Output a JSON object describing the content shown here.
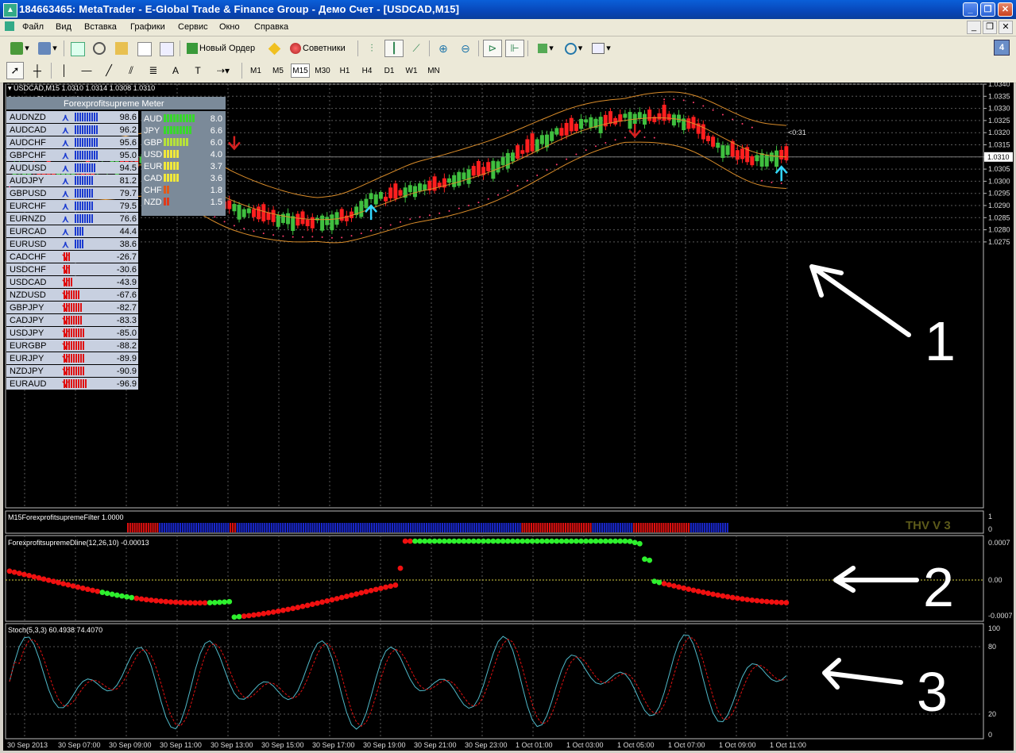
{
  "window": {
    "title": "184663465: MetaTrader - E-Global Trade & Finance Group - Демо Счет - [USDCAD,M15]",
    "minimize": "_",
    "restore": "❐",
    "close": "✕"
  },
  "menu": {
    "items": [
      "Файл",
      "Вид",
      "Вставка",
      "Графики",
      "Сервис",
      "Окно",
      "Справка"
    ],
    "mdi": [
      "_",
      "❐",
      "✕"
    ]
  },
  "toolbar": {
    "new_order": "Новый Ордер",
    "experts": "Советники",
    "badge": "4"
  },
  "timeframes": [
    "M1",
    "M5",
    "M15",
    "M30",
    "H1",
    "H4",
    "D1",
    "W1",
    "MN"
  ],
  "active_timeframe": "M15",
  "chart": {
    "symbol_header": "USDCAD,M15  1.0310 1.0314 1.0308 1.0310",
    "timer_text": "0 minutes 31 seconds left to bar end",
    "current_price": "1.0310",
    "price_tag": "<0:31",
    "price_axis": [
      "1.0340",
      "1.0335",
      "1.0330",
      "1.0325",
      "1.0320",
      "1.0315",
      "1.0310",
      "1.0305",
      "1.0300",
      "1.0295",
      "1.0290",
      "1.0285",
      "1.0280",
      "1.0275"
    ],
    "time_axis": [
      "30 Sep 2013",
      "30 Sep 07:00",
      "30 Sep 09:00",
      "30 Sep 11:00",
      "30 Sep 13:00",
      "30 Sep 15:00",
      "30 Sep 17:00",
      "30 Sep 19:00",
      "30 Sep 21:00",
      "30 Sep 23:00",
      "1 Oct 01:00",
      "1 Oct 03:00",
      "1 Oct 05:00",
      "1 Oct 07:00",
      "1 Oct 09:00",
      "1 Oct 11:00"
    ],
    "colors": {
      "bull": "#3fbf3f",
      "bear": "#ff1f1f",
      "band": "#d98c2a",
      "arrow_up": "#33d6ff",
      "arrow_down": "#d42020",
      "sar": "#ff3b6b"
    }
  },
  "meter": {
    "title": "Forexprofitsupreme Meter",
    "pairs": [
      {
        "pair": "AUDNZD",
        "value": "98.6",
        "dir": "up"
      },
      {
        "pair": "AUDCAD",
        "value": "96.2",
        "dir": "up"
      },
      {
        "pair": "AUDCHF",
        "value": "95.6",
        "dir": "up"
      },
      {
        "pair": "GBPCHF",
        "value": "95.0",
        "dir": "up"
      },
      {
        "pair": "AUDUSD",
        "value": "94.5",
        "dir": "up"
      },
      {
        "pair": "AUDJPY",
        "value": "81.2",
        "dir": "up"
      },
      {
        "pair": "GBPUSD",
        "value": "79.7",
        "dir": "up"
      },
      {
        "pair": "EURCHF",
        "value": "79.5",
        "dir": "up"
      },
      {
        "pair": "EURNZD",
        "value": "76.6",
        "dir": "up"
      },
      {
        "pair": "EURCAD",
        "value": "44.4",
        "dir": "up"
      },
      {
        "pair": "EURUSD",
        "value": "38.6",
        "dir": "up"
      },
      {
        "pair": "CADCHF",
        "value": "-26.7",
        "dir": "down"
      },
      {
        "pair": "USDCHF",
        "value": "-30.6",
        "dir": "down"
      },
      {
        "pair": "USDCAD",
        "value": "-43.9",
        "dir": "down"
      },
      {
        "pair": "NZDUSD",
        "value": "-67.6",
        "dir": "down"
      },
      {
        "pair": "GBPJPY",
        "value": "-82.7",
        "dir": "down"
      },
      {
        "pair": "CADJPY",
        "value": "-83.3",
        "dir": "down"
      },
      {
        "pair": "USDJPY",
        "value": "-85.0",
        "dir": "down"
      },
      {
        "pair": "EURGBP",
        "value": "-88.2",
        "dir": "down"
      },
      {
        "pair": "EURJPY",
        "value": "-89.9",
        "dir": "down"
      },
      {
        "pair": "NZDJPY",
        "value": "-90.9",
        "dir": "down"
      },
      {
        "pair": "EURAUD",
        "value": "-96.9",
        "dir": "down"
      }
    ],
    "currencies": [
      {
        "cur": "AUD",
        "value": "8.0",
        "bars": 10,
        "color": "#39d82c"
      },
      {
        "cur": "JPY",
        "value": "6.6",
        "bars": 9,
        "color": "#39d82c"
      },
      {
        "cur": "GBP",
        "value": "6.0",
        "bars": 8,
        "color": "#b6e23a"
      },
      {
        "cur": "USD",
        "value": "4.0",
        "bars": 5,
        "color": "#f0e83a"
      },
      {
        "cur": "EUR",
        "value": "3.7",
        "bars": 5,
        "color": "#f0e83a"
      },
      {
        "cur": "CAD",
        "value": "3.6",
        "bars": 5,
        "color": "#f0e83a"
      },
      {
        "cur": "CHF",
        "value": "1.8",
        "bars": 2,
        "color": "#e05a1a"
      },
      {
        "cur": "NZD",
        "value": "1.5",
        "bars": 2,
        "color": "#e03a1a"
      }
    ]
  },
  "filter_pane": {
    "label": "M15ForexprofitsupremeFilter 1.0000",
    "watermark": "THV V 3",
    "axis": [
      "1",
      "0"
    ],
    "segments": [
      {
        "color": "red",
        "bars": 14
      },
      {
        "color": "blue",
        "bars": 31
      },
      {
        "color": "red",
        "bars": 3
      },
      {
        "color": "blue",
        "bars": 125
      },
      {
        "color": "red",
        "bars": 31
      },
      {
        "color": "blue",
        "bars": 18
      },
      {
        "color": "red",
        "bars": 25
      },
      {
        "color": "blue",
        "bars": 17
      }
    ]
  },
  "dline_pane": {
    "label": "ForexprofitsupremeDline(12,26,10) -0.00013",
    "axis": [
      "0.0007",
      "0.00",
      "-0.0007"
    ]
  },
  "stoch_pane": {
    "label": "Stoch(5,3,3) 60.4938 74.4070",
    "axis": [
      "100",
      "80",
      "20",
      "0"
    ]
  },
  "annotations": [
    "1",
    "2",
    "3"
  ]
}
